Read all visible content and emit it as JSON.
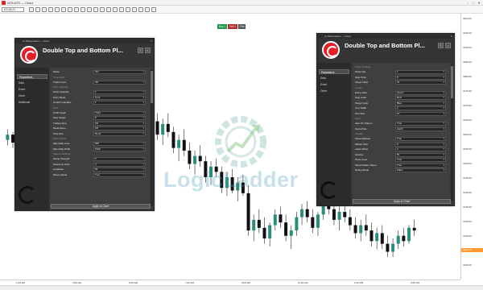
{
  "app": {
    "title": "NT8 ATS — Chart",
    "minimize": "–",
    "maximize": "□",
    "close": "✕"
  },
  "toolbar": {
    "symbol": "ES 06-21"
  },
  "banner": {
    "labels": [
      "Buy 1",
      "Sell 1",
      "Flat"
    ]
  },
  "watermark": {
    "text": "LogicLadder"
  },
  "price_axis": {
    "ticks": [
      "4200.00",
      "4195.00",
      "4190.00",
      "4185.00",
      "4180.00",
      "4175.00",
      "4170.00",
      "4165.00",
      "4160.00",
      "4155.00",
      "4150.00",
      "4145.00",
      "4140.00",
      "4135.00",
      "4130.00",
      "4125.00",
      "4120.00",
      "4115.00"
    ],
    "current": "4130.75",
    "current_color": "#ff9a30"
  },
  "time_axis": {
    "ticks": [
      "1:00 AM",
      "3:00 AM",
      "5:00 AM",
      "7:00 AM",
      "9:00 AM",
      "11:00 AM",
      "1:00 PM",
      "3:00 PM"
    ]
  },
  "chart_data": {
    "type": "candlestick",
    "up_color": "#2a8f7a",
    "down_color": "#111111",
    "ylim": [
      4110,
      4205
    ],
    "ohlc": [
      [
        4160,
        4164,
        4158,
        4162
      ],
      [
        4162,
        4163,
        4157,
        4159
      ],
      [
        4159,
        4166,
        4158,
        4165
      ],
      [
        4165,
        4167,
        4161,
        4162
      ],
      [
        4162,
        4165,
        4160,
        4164
      ],
      [
        4164,
        4168,
        4162,
        4167
      ],
      [
        4167,
        4169,
        4163,
        4164
      ],
      [
        4164,
        4166,
        4160,
        4161
      ],
      [
        4161,
        4165,
        4159,
        4164
      ],
      [
        4164,
        4170,
        4163,
        4169
      ],
      [
        4169,
        4172,
        4166,
        4167
      ],
      [
        4167,
        4170,
        4164,
        4169
      ],
      [
        4169,
        4174,
        4167,
        4172
      ],
      [
        4172,
        4174,
        4168,
        4169
      ],
      [
        4169,
        4171,
        4165,
        4166
      ],
      [
        4166,
        4170,
        4164,
        4169
      ],
      [
        4169,
        4173,
        4167,
        4171
      ],
      [
        4171,
        4176,
        4170,
        4175
      ],
      [
        4175,
        4178,
        4172,
        4173
      ],
      [
        4173,
        4175,
        4169,
        4170
      ],
      [
        4170,
        4178,
        4169,
        4177
      ],
      [
        4177,
        4182,
        4175,
        4180
      ],
      [
        4180,
        4186,
        4178,
        4184
      ],
      [
        4184,
        4190,
        4182,
        4188
      ],
      [
        4188,
        4194,
        4185,
        4191
      ],
      [
        4191,
        4193,
        4178,
        4180
      ],
      [
        4180,
        4182,
        4170,
        4172
      ],
      [
        4172,
        4176,
        4165,
        4167
      ],
      [
        4167,
        4170,
        4160,
        4162
      ],
      [
        4162,
        4168,
        4158,
        4166
      ],
      [
        4166,
        4170,
        4161,
        4163
      ],
      [
        4163,
        4165,
        4155,
        4157
      ],
      [
        4157,
        4162,
        4152,
        4160
      ],
      [
        4160,
        4164,
        4154,
        4156
      ],
      [
        4156,
        4159,
        4149,
        4151
      ],
      [
        4151,
        4156,
        4147,
        4154
      ],
      [
        4154,
        4158,
        4150,
        4152
      ],
      [
        4152,
        4154,
        4144,
        4146
      ],
      [
        4146,
        4152,
        4143,
        4150
      ],
      [
        4150,
        4153,
        4146,
        4148
      ],
      [
        4148,
        4150,
        4140,
        4142
      ],
      [
        4142,
        4148,
        4139,
        4146
      ],
      [
        4146,
        4149,
        4140,
        4141
      ],
      [
        4141,
        4146,
        4137,
        4144
      ],
      [
        4144,
        4147,
        4139,
        4140
      ],
      [
        4140,
        4143,
        4124,
        4126
      ],
      [
        4126,
        4132,
        4122,
        4130
      ],
      [
        4130,
        4134,
        4125,
        4127
      ],
      [
        4127,
        4131,
        4121,
        4123
      ],
      [
        4123,
        4129,
        4120,
        4128
      ],
      [
        4128,
        4134,
        4126,
        4132
      ],
      [
        4132,
        4135,
        4127,
        4129
      ],
      [
        4129,
        4132,
        4122,
        4124
      ],
      [
        4124,
        4128,
        4119,
        4126
      ],
      [
        4126,
        4133,
        4124,
        4131
      ],
      [
        4131,
        4136,
        4128,
        4134
      ],
      [
        4134,
        4137,
        4129,
        4131
      ],
      [
        4131,
        4134,
        4125,
        4127
      ],
      [
        4127,
        4133,
        4124,
        4132
      ],
      [
        4132,
        4138,
        4130,
        4136
      ],
      [
        4136,
        4140,
        4132,
        4134
      ],
      [
        4134,
        4136,
        4128,
        4130
      ],
      [
        4130,
        4135,
        4126,
        4133
      ],
      [
        4133,
        4137,
        4129,
        4131
      ],
      [
        4131,
        4134,
        4126,
        4128
      ],
      [
        4128,
        4131,
        4123,
        4125
      ],
      [
        4125,
        4130,
        4122,
        4128
      ],
      [
        4128,
        4132,
        4124,
        4126
      ],
      [
        4126,
        4129,
        4120,
        4122
      ],
      [
        4122,
        4127,
        4119,
        4125
      ],
      [
        4125,
        4128,
        4119,
        4121
      ],
      [
        4121,
        4124,
        4116,
        4118
      ],
      [
        4118,
        4123,
        4116,
        4121
      ],
      [
        4121,
        4126,
        4119,
        4124
      ],
      [
        4124,
        4127,
        4120,
        4122
      ],
      [
        4122,
        4128,
        4121,
        4127
      ],
      [
        4127,
        4130,
        4124,
        4126
      ]
    ]
  },
  "panels": [
    {
      "window_title": "LL Multi-pattern — Chart",
      "title": "Double Top and Bottom Pl...",
      "sidebar": [
        "Parameters",
        "Data",
        "Event",
        "Order",
        "Additional"
      ],
      "apply_label": "Apply to Chart",
      "rows": [
        {
          "type": "row",
          "label": "Mode",
          "value": "Sim"
        },
        {
          "type": "section",
          "label": "Time Filter"
        },
        {
          "type": "row",
          "label": "Trade hours",
          "value": "Off"
        },
        {
          "type": "section",
          "label": "Entry Settings"
        },
        {
          "type": "row",
          "label": "Order Quantity",
          "value": "1"
        },
        {
          "type": "row",
          "label": "Entry Mode",
          "value": "Limit"
        },
        {
          "type": "row",
          "label": "Confirm Candles",
          "value": "1"
        },
        {
          "type": "section",
          "label": "Exits"
        },
        {
          "type": "row",
          "label": "Profit Target",
          "value": "Ticks"
        },
        {
          "type": "row",
          "label": "Stop Target",
          "value": "8"
        },
        {
          "type": "row",
          "label": "Trailing Stop",
          "value": "Off"
        },
        {
          "type": "row",
          "label": "Break Even",
          "value": "Off"
        },
        {
          "type": "row",
          "label": "Time Exit",
          "value": "None"
        },
        {
          "type": "section",
          "label": "Risk Control"
        },
        {
          "type": "row",
          "label": "Max Daily Loss",
          "value": "500"
        },
        {
          "type": "row",
          "label": "Max Daily Profit",
          "value": "1000"
        },
        {
          "type": "section",
          "label": "Pattern Settings"
        },
        {
          "type": "row",
          "label": "Swing Strength",
          "value": "5"
        },
        {
          "type": "row",
          "label": "Tolerance Ticks",
          "value": "4"
        },
        {
          "type": "row",
          "label": "Lookback",
          "value": "50"
        },
        {
          "type": "row",
          "label": "Show Labels",
          "value": "True"
        }
      ]
    },
    {
      "window_title": "LL Multi-pattern — Chart",
      "title": "Double Top and Bottom Pl...",
      "sidebar": [
        "Parameters",
        "Data",
        "Event",
        "Order"
      ],
      "apply_label": "Apply to Chart",
      "rows": [
        {
          "type": "section",
          "label": "Order Settings"
        },
        {
          "type": "row",
          "label": "Order Qty",
          "value": "1"
        },
        {
          "type": "row",
          "label": "Stop Ticks",
          "value": "8"
        },
        {
          "type": "row",
          "label": "Target Ticks",
          "value": "16"
        },
        {
          "type": "section",
          "label": "Levels"
        },
        {
          "type": "row",
          "label": "Entry Color",
          "value": "Green"
        },
        {
          "type": "row",
          "label": "Stop Color",
          "value": "Red"
        },
        {
          "type": "row",
          "label": "Target Color",
          "value": "Blue"
        },
        {
          "type": "row",
          "label": "Line Width",
          "value": "2"
        },
        {
          "type": "row",
          "label": "Text Size",
          "value": "10"
        },
        {
          "type": "section",
          "label": "Alerts"
        },
        {
          "type": "row",
          "label": "Alert On Pattern",
          "value": "True"
        },
        {
          "type": "row",
          "label": "Sound File",
          "value": "Alert1"
        },
        {
          "type": "section",
          "label": "Visuals"
        },
        {
          "type": "row",
          "label": "Show Markers",
          "value": "True"
        },
        {
          "type": "row",
          "label": "Marker Size",
          "value": "3"
        },
        {
          "type": "row",
          "label": "Label Offset",
          "value": "2"
        },
        {
          "type": "row",
          "label": "Opacity",
          "value": "80"
        },
        {
          "type": "row",
          "label": "Draw Lines",
          "value": "True"
        },
        {
          "type": "row",
          "label": "Show Pattern Name",
          "value": "True"
        },
        {
          "type": "row",
          "label": "Debug Mode",
          "value": "False"
        }
      ]
    }
  ]
}
